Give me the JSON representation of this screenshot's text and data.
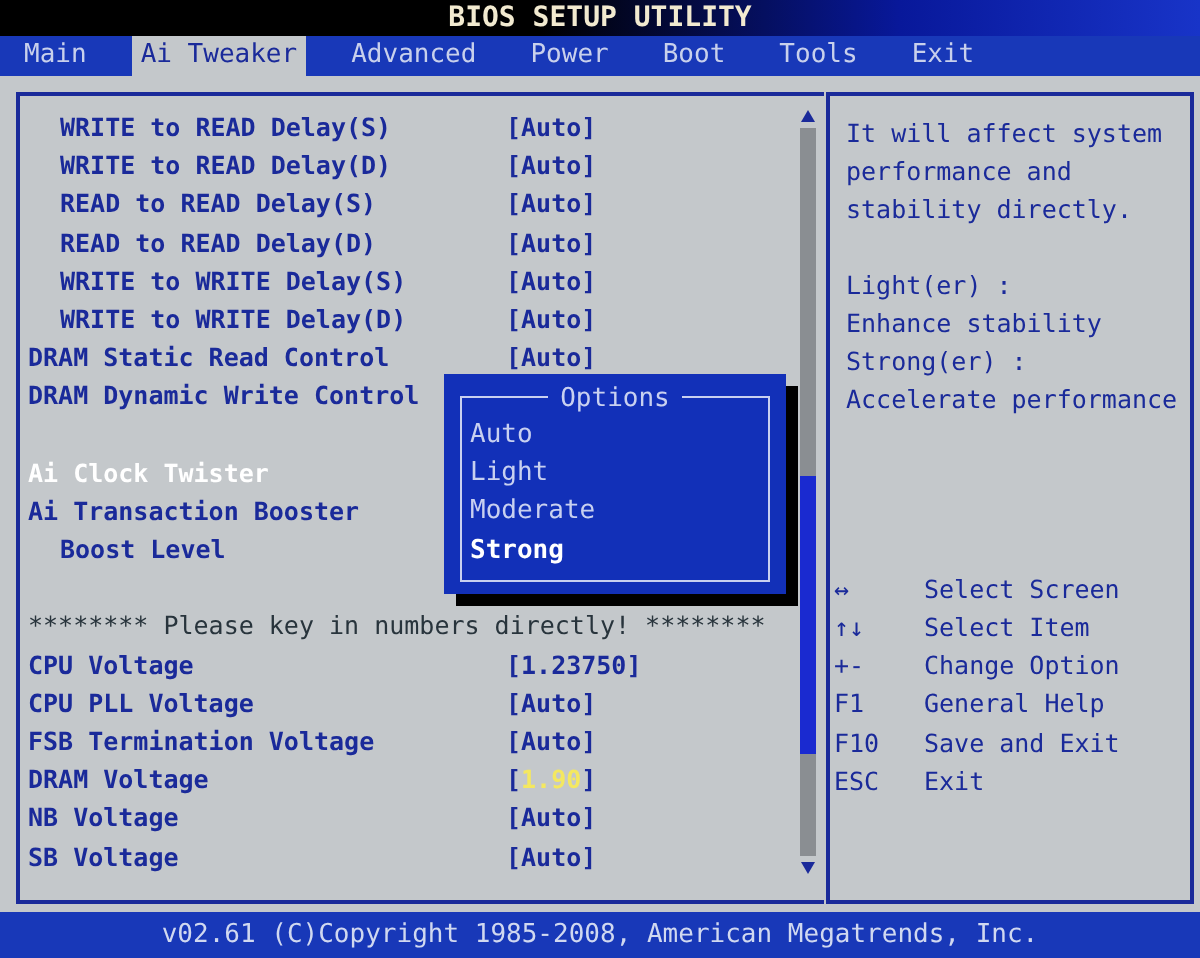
{
  "window": {
    "title": "BIOS SETUP UTILITY"
  },
  "tabs": [
    {
      "label": "Main",
      "selected": false
    },
    {
      "label": "Ai Tweaker",
      "selected": true
    },
    {
      "label": "Advanced",
      "selected": false
    },
    {
      "label": "Power",
      "selected": false
    },
    {
      "label": "Boot",
      "selected": false
    },
    {
      "label": "Tools",
      "selected": false
    },
    {
      "label": "Exit",
      "selected": false
    }
  ],
  "settings": {
    "rows": [
      {
        "kind": "continued",
        "children": [
          {
            "kind": "setting",
            "label": "WRITE to READ Delay(S)",
            "value": "[Auto]",
            "selected": false
          },
          {
            "kind": "setting",
            "label": "WRITE to READ Delay(D)",
            "value": "[Auto]",
            "selected": false
          },
          {
            "kind": "setting",
            "label": "READ to READ Delay(S)",
            "value": "[Auto]",
            "selected": false
          },
          {
            "kind": "setting",
            "label": "READ to READ Delay(D)",
            "value": "[Auto]",
            "selected": false
          },
          {
            "kind": "setting",
            "label": "WRITE to WRITE Delay(S)",
            "value": "[Auto]",
            "selected": false
          },
          {
            "kind": "setting",
            "label": "WRITE to WRITE Delay(D)",
            "value": "[Auto]",
            "selected": false
          }
        ]
      },
      {
        "kind": "setting",
        "label": "DRAM Static Read Control",
        "value": "[Auto]",
        "selected": false
      },
      {
        "kind": "setting",
        "label": "DRAM Dynamic Write Control",
        "selected": false
      },
      {
        "kind": "spacer"
      },
      {
        "kind": "setting",
        "label": "Ai Clock Twister",
        "selected": true
      },
      {
        "kind": "setting",
        "label": "Ai Transaction Booster",
        "selected": false,
        "children": [
          {
            "kind": "setting",
            "label": "Boost Level",
            "selected": false
          }
        ]
      },
      {
        "kind": "spacer"
      },
      {
        "kind": "note",
        "label": "******** Please key in numbers directly! ********"
      },
      {
        "kind": "setting",
        "label": "CPU Voltage",
        "value": "[1.23750]",
        "selected": false
      },
      {
        "kind": "setting",
        "label": "CPU PLL Voltage",
        "value": "[Auto]",
        "selected": false
      },
      {
        "kind": "setting",
        "label": "FSB Termination Voltage",
        "value": "[Auto]",
        "selected": false
      },
      {
        "kind": "setting",
        "label": "DRAM Voltage",
        "value": "[1.90]",
        "editing": true,
        "selected": false
      },
      {
        "kind": "setting",
        "label": "NB Voltage",
        "value": "[Auto]",
        "selected": false
      },
      {
        "kind": "setting",
        "label": "SB Voltage",
        "value": "[Auto]",
        "selected": false
      }
    ]
  },
  "options_popup": {
    "title": "Options",
    "options": [
      {
        "label": "Auto",
        "selected": false
      },
      {
        "label": "Light",
        "selected": false
      },
      {
        "label": "Moderate",
        "selected": false
      },
      {
        "label": "Strong",
        "selected": true
      }
    ]
  },
  "help": {
    "description": [
      "It will affect system",
      "performance and",
      "stability directly."
    ],
    "details": [
      "Light(er) :",
      "Enhance stability",
      "Strong(er) :",
      "Accelerate performance"
    ],
    "keys": [
      {
        "key": "↔",
        "action": "Select Screen"
      },
      {
        "key": "↑↓",
        "action": "Select Item"
      },
      {
        "key": "+-",
        "action": "Change Option"
      },
      {
        "key": "F1",
        "action": "General Help"
      },
      {
        "key": "F10",
        "action": "Save and Exit"
      },
      {
        "key": "ESC",
        "action": "Exit"
      }
    ]
  },
  "footer": "v02.61 (C)Copyright 1985-2008, American Megatrends, Inc."
}
